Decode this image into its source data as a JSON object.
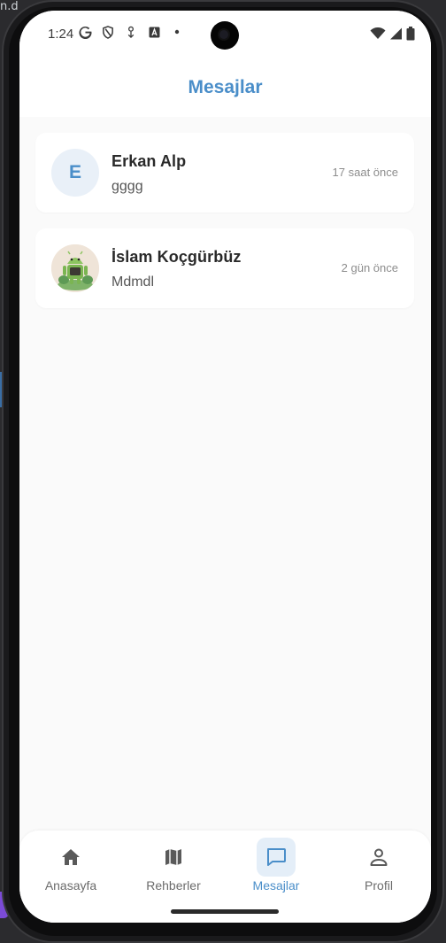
{
  "backdrop": {
    "text": "n.d"
  },
  "status_bar": {
    "time": "1:24",
    "left_icons": [
      "google-icon",
      "shield-icon",
      "download-icon",
      "store-icon",
      "dot-icon"
    ],
    "right_icons": [
      "wifi-icon",
      "signal-icon",
      "battery-icon"
    ]
  },
  "app_bar": {
    "title": "Mesajlar"
  },
  "chats": [
    {
      "name": "Erkan Alp",
      "preview": "gggg",
      "time": "17 saat önce",
      "avatar_letter": "E"
    },
    {
      "name": "İslam Koçgürbüz",
      "preview": "Mdmdl",
      "time": "2 gün önce",
      "avatar": "android-robot-image"
    }
  ],
  "bottom_nav": {
    "items": [
      {
        "label": "Anasayfa",
        "icon": "home-icon"
      },
      {
        "label": "Rehberler",
        "icon": "map-icon"
      },
      {
        "label": "Mesajlar",
        "icon": "chat-icon",
        "active": true
      },
      {
        "label": "Profil",
        "icon": "person-icon"
      }
    ]
  },
  "colors": {
    "accent": "#4a8ec9",
    "active_bg": "#e4eef8",
    "background": "#fafafa"
  }
}
